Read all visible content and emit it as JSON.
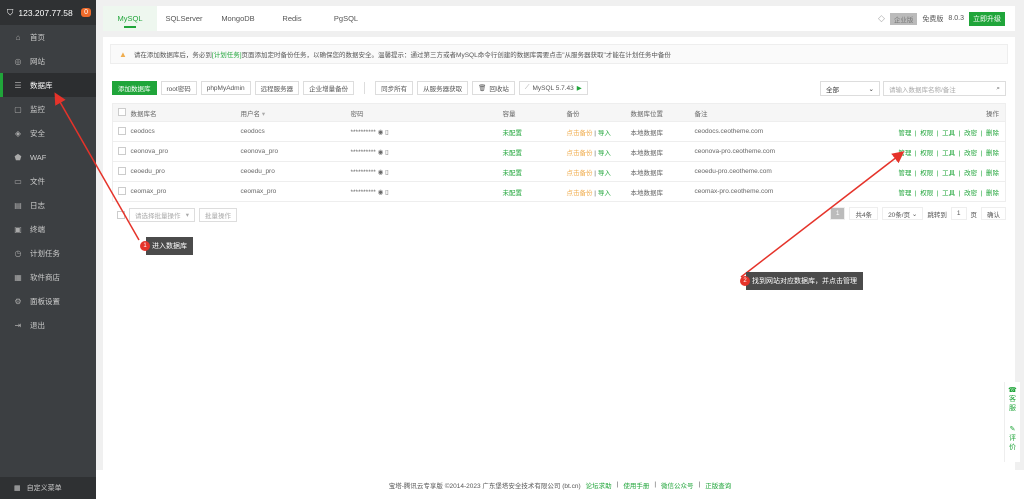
{
  "sidebar": {
    "ip": "123.207.77.58",
    "badge": "0",
    "items": [
      {
        "label": "首页",
        "icon": "home-icon",
        "glyph": "⌂"
      },
      {
        "label": "网站",
        "icon": "globe-icon",
        "glyph": "◎"
      },
      {
        "label": "数据库",
        "icon": "database-icon",
        "glyph": "☰"
      },
      {
        "label": "监控",
        "icon": "monitor-icon",
        "glyph": "▢"
      },
      {
        "label": "安全",
        "icon": "shield-icon",
        "glyph": "◈"
      },
      {
        "label": "WAF",
        "icon": "waf-icon",
        "glyph": "⬟"
      },
      {
        "label": "文件",
        "icon": "folder-icon",
        "glyph": "▭"
      },
      {
        "label": "日志",
        "icon": "log-icon",
        "glyph": "▤"
      },
      {
        "label": "终端",
        "icon": "terminal-icon",
        "glyph": "▣"
      },
      {
        "label": "计划任务",
        "icon": "clock-icon",
        "glyph": "◷"
      },
      {
        "label": "软件商店",
        "icon": "store-icon",
        "glyph": "▦"
      },
      {
        "label": "面板设置",
        "icon": "settings-icon",
        "glyph": "⚙"
      },
      {
        "label": "退出",
        "icon": "logout-icon",
        "glyph": "⇥"
      }
    ],
    "custom_menu": "自定义菜单"
  },
  "tabs": [
    "MySQL",
    "SQLServer",
    "MongoDB",
    "Redis",
    "PgSQL"
  ],
  "version": {
    "enterprise": "企业版",
    "free": "免费版",
    "number": "8.0.3",
    "upgrade": "立即升级"
  },
  "notice": {
    "pre": "请在添加数据库后，务必到",
    "link": "[计划任务]",
    "post": "页面添加定时备份任务，以确保您的数据安全。温馨提示：通过第三方或者MySQL命令行创建的数据库需要点击\"从服务器获取\"才能在计划任务中备份"
  },
  "toolbar": {
    "add": "添加数据库",
    "root": "root密码",
    "pma": "phpMyAdmin",
    "remote": "远程服务器",
    "backup": "企业增量备份",
    "sync": "同步所有",
    "fetch": "从服务器获取",
    "recycle": "回收站",
    "mysql": "MySQL 5.7.43"
  },
  "filter": {
    "select": "全部",
    "search_placeholder": "请输入数据库名称/备注"
  },
  "table": {
    "headers": [
      "数据库名",
      "用户名",
      "密码",
      "容量",
      "备份",
      "数据库位置",
      "备注",
      "操作"
    ],
    "rows": [
      {
        "name": "ceodocs",
        "user": "ceodocs",
        "pwd": "**********",
        "cap": "未配置",
        "bk": "点击备份",
        "imp": "导入",
        "loc": "本地数据库",
        "note": "ceodocs.ceotheme.com"
      },
      {
        "name": "ceonova_pro",
        "user": "ceonova_pro",
        "pwd": "**********",
        "cap": "未配置",
        "bk": "点击备份",
        "imp": "导入",
        "loc": "本地数据库",
        "note": "ceonova-pro.ceotheme.com"
      },
      {
        "name": "ceoedu_pro",
        "user": "ceoedu_pro",
        "pwd": "**********",
        "cap": "未配置",
        "bk": "点击备份",
        "imp": "导入",
        "loc": "本地数据库",
        "note": "ceoedu-pro.ceotheme.com"
      },
      {
        "name": "ceomax_pro",
        "user": "ceomax_pro",
        "pwd": "**********",
        "cap": "未配置",
        "bk": "点击备份",
        "imp": "导入",
        "loc": "本地数据库",
        "note": "ceomax-pro.ceotheme.com"
      }
    ],
    "ops": [
      "管理",
      "权限",
      "工具",
      "改密",
      "删除"
    ]
  },
  "batch": {
    "select": "请选择批量操作",
    "btn": "批量操作"
  },
  "pager": {
    "page": "1",
    "total": "共4条",
    "per": "20条/页",
    "goto": "跳转到",
    "input": "1",
    "unit": "页",
    "confirm": "确认"
  },
  "footer": {
    "copy": "宝塔-腾讯云专享版 ©2014-2023 广东堡塔安全技术有限公司 (bt.cn)",
    "links": [
      "论坛求助",
      "使用手册",
      "微信公众号",
      "正版查询"
    ]
  },
  "float": {
    "service": "客服",
    "review": "评价"
  },
  "annotations": [
    {
      "num": "1",
      "text": "进入数据库"
    },
    {
      "num": "2",
      "text": "找到网站对应数据库，并点击管理"
    }
  ]
}
